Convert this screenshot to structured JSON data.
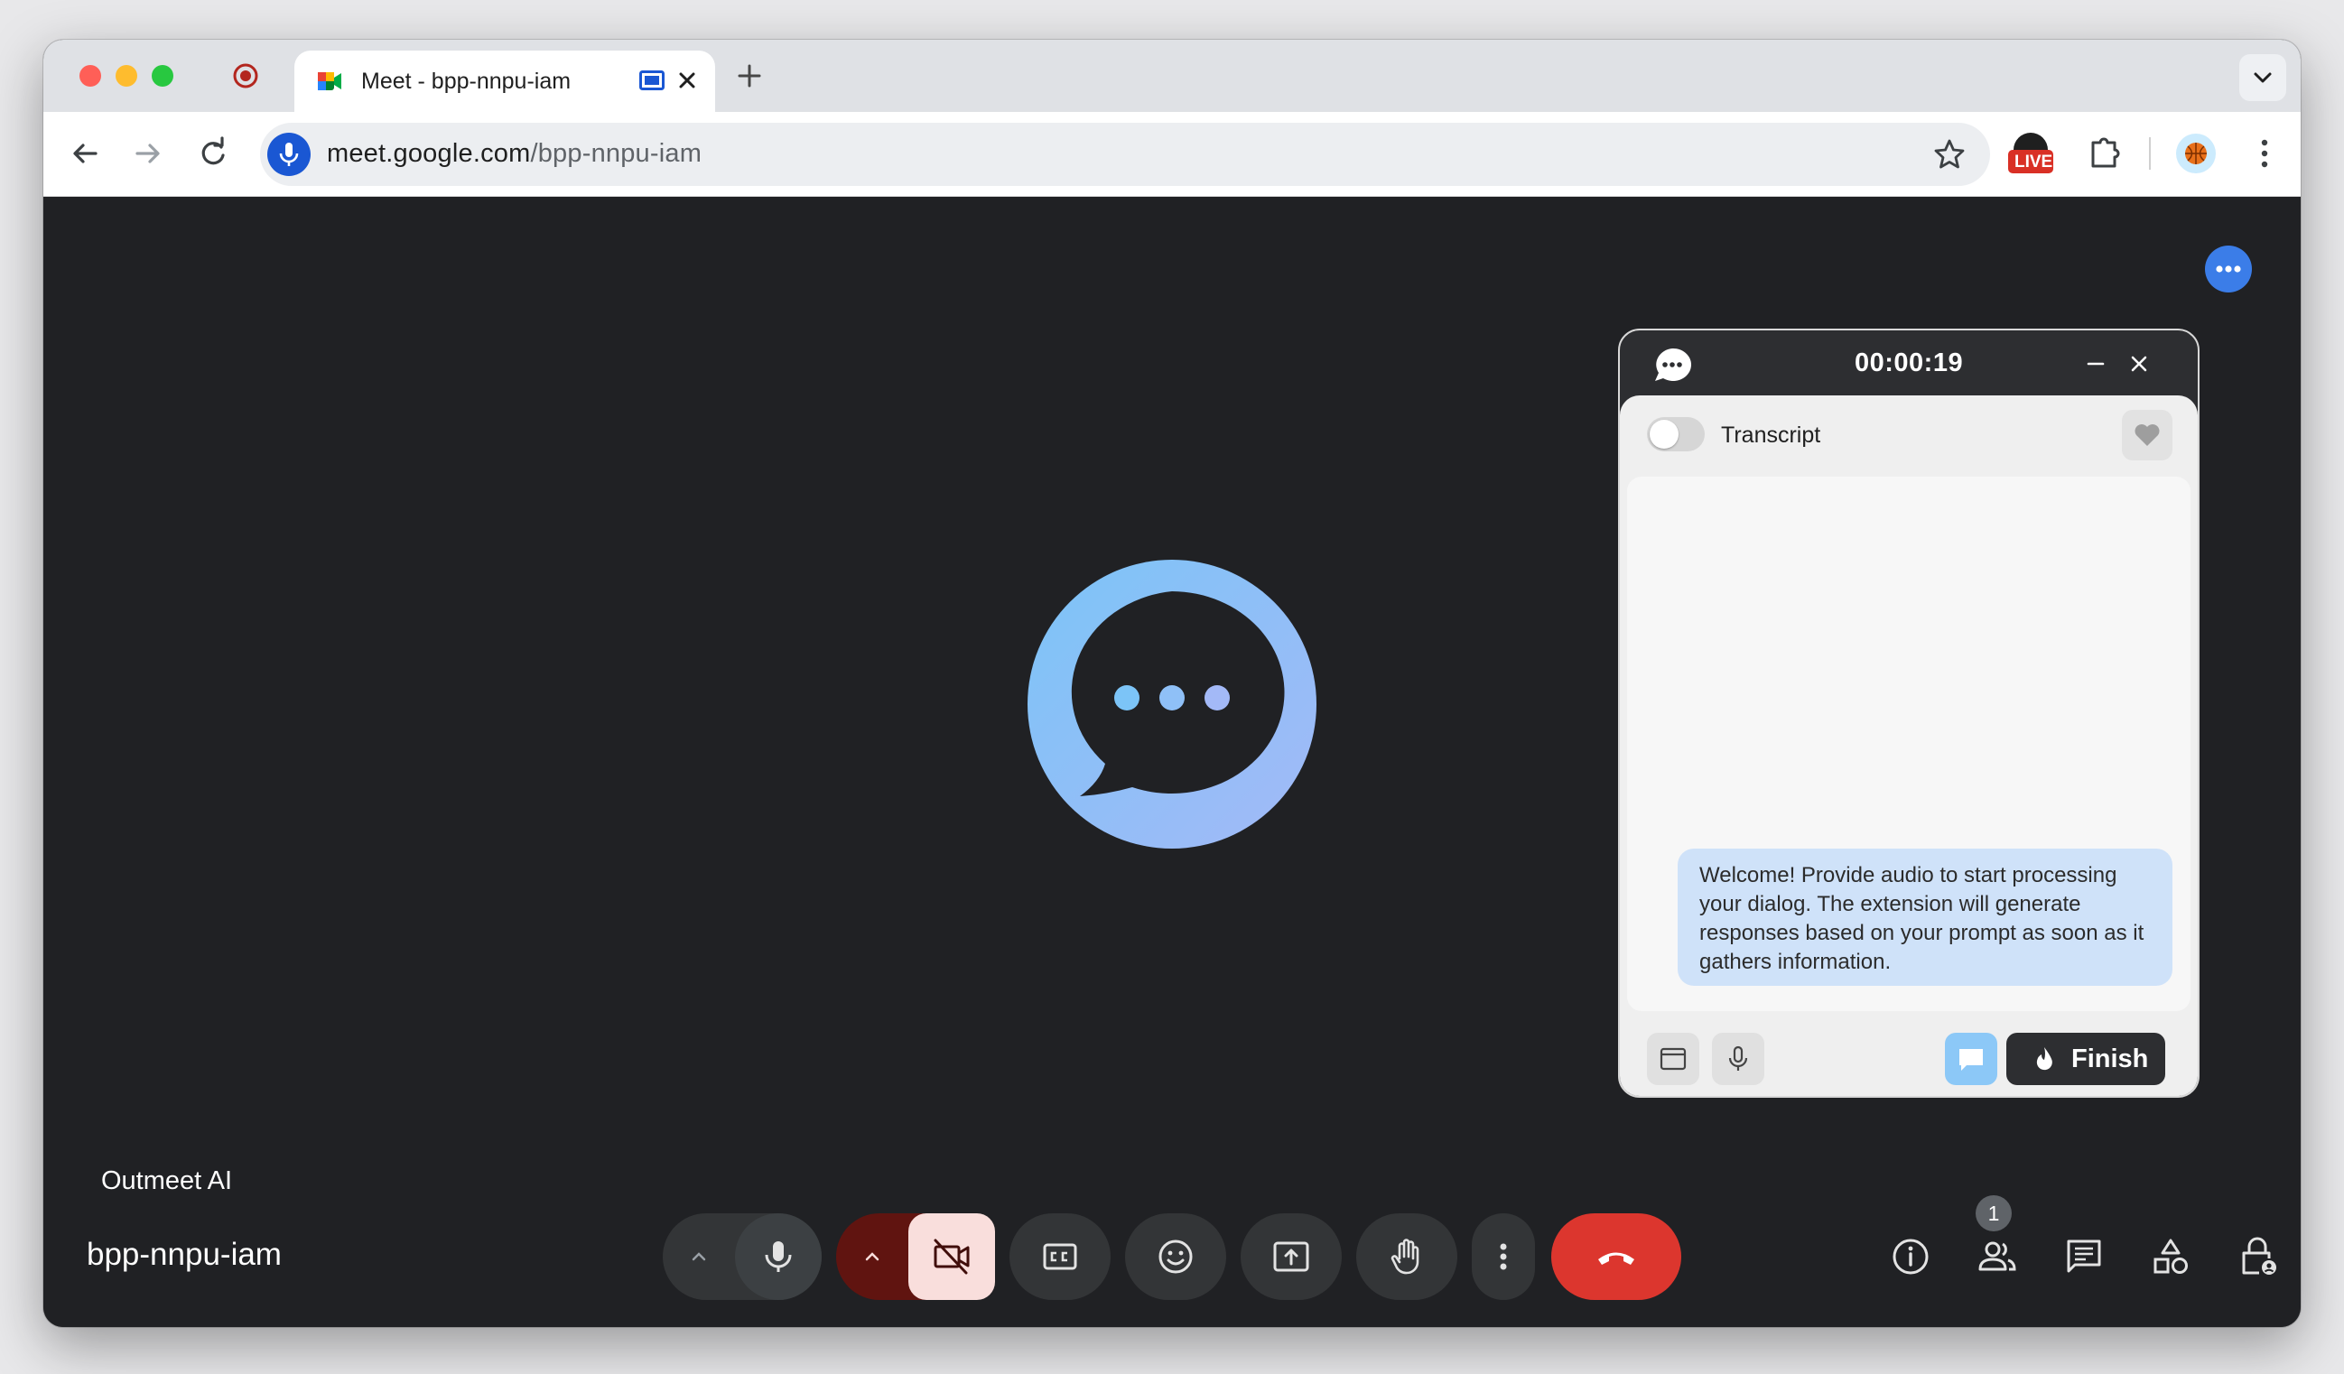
{
  "browser": {
    "tab": {
      "title": "Meet - bpp-nnpu-iam"
    },
    "address_bar": {
      "domain": "meet.google.com",
      "path": "/bpp-nnpu-iam"
    },
    "extensions": {
      "live_badge": "LIVE"
    }
  },
  "meet": {
    "participant_name": "Outmeet AI",
    "meeting_code": "bpp-nnpu-iam",
    "people_count": "1",
    "colors": {
      "stage_bg": "#202124",
      "control_bg": "#333537",
      "end_call": "#dc362e",
      "camera_off_bg": "#f9dedc",
      "camera_dropdown_bg": "#601410"
    },
    "controls": [
      {
        "name": "mic-options-chevron-icon"
      },
      {
        "name": "microphone-icon"
      },
      {
        "name": "camera-options-chevron-icon"
      },
      {
        "name": "camera-off-icon"
      },
      {
        "name": "captions-icon"
      },
      {
        "name": "emoji-icon"
      },
      {
        "name": "present-screen-icon"
      },
      {
        "name": "raise-hand-icon"
      },
      {
        "name": "more-options-icon"
      },
      {
        "name": "end-call-icon"
      }
    ],
    "right_controls": [
      {
        "name": "meeting-info-icon"
      },
      {
        "name": "people-icon"
      },
      {
        "name": "chat-icon"
      },
      {
        "name": "activities-icon"
      },
      {
        "name": "host-controls-icon"
      }
    ]
  },
  "outmeet_widget": {
    "timer": "00:00:19",
    "transcript_label": "Transcript",
    "transcript_enabled": false,
    "welcome_message": "Welcome! Provide audio to start processing your dialog. The extension will generate responses based on your prompt as soon as it gathers information.",
    "finish_label": "Finish",
    "accent": "#8cc8f7"
  }
}
